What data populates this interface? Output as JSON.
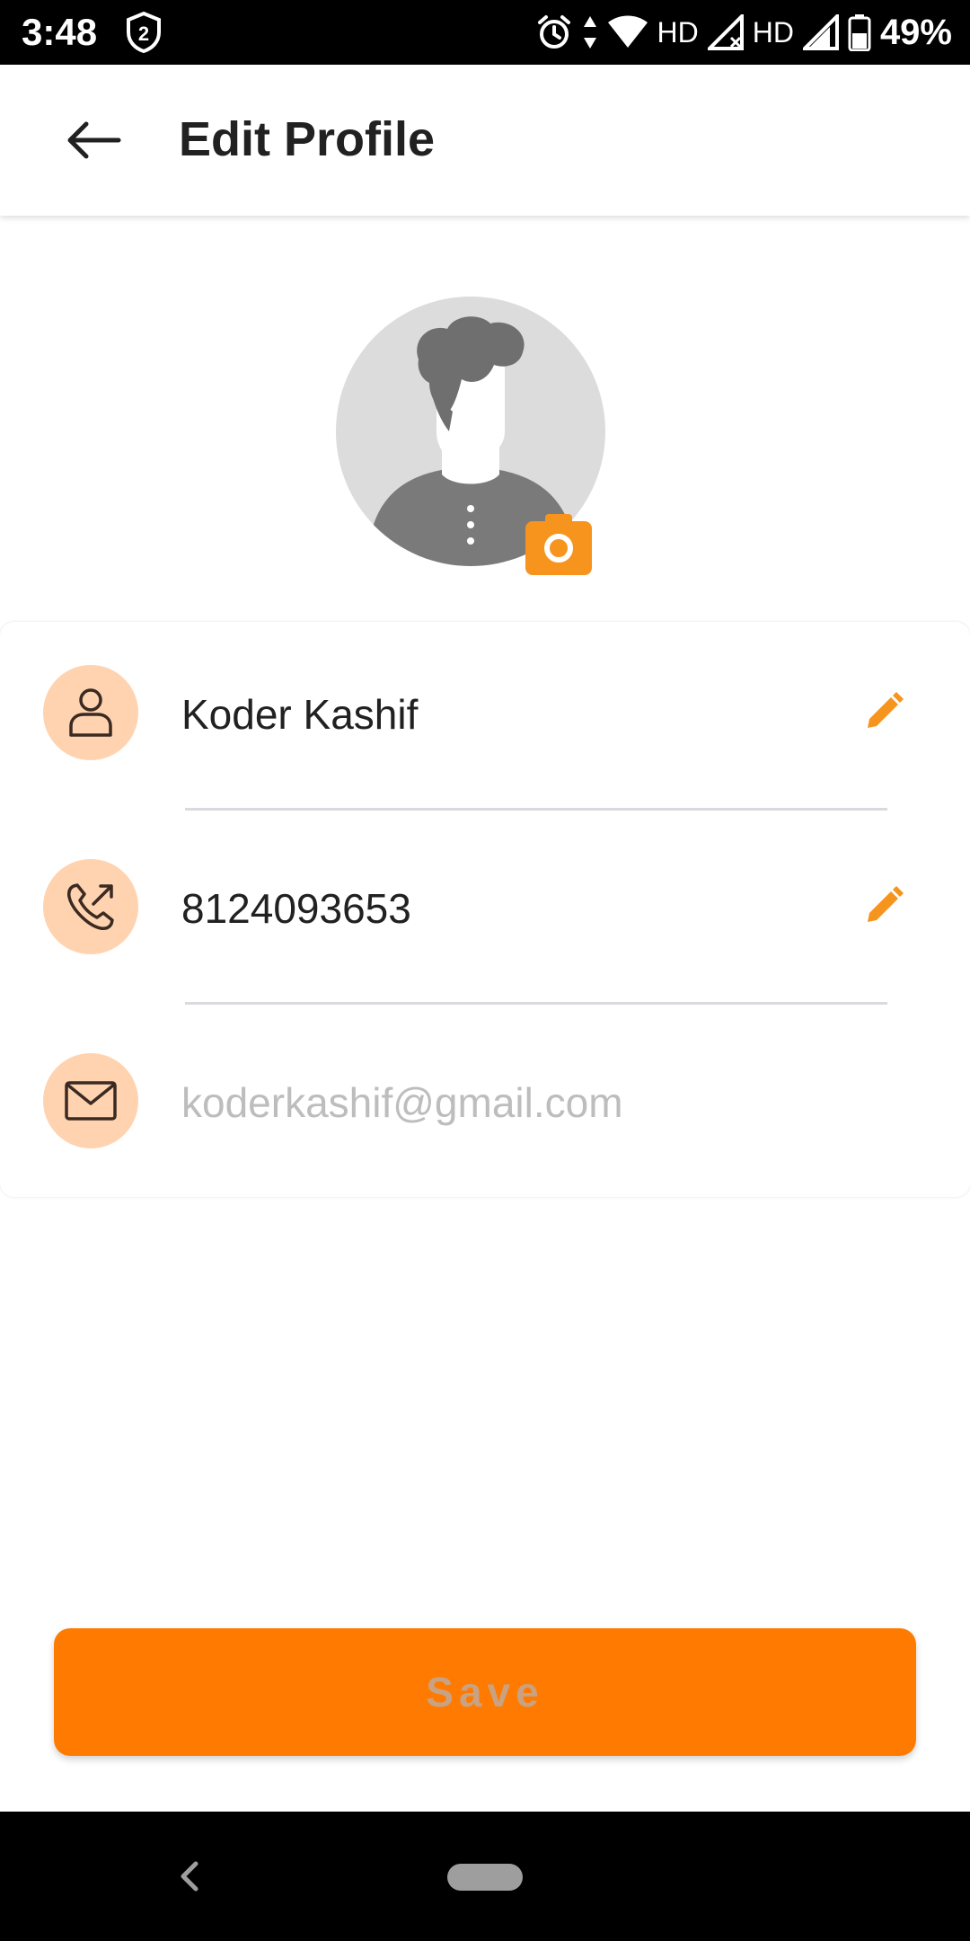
{
  "status_bar": {
    "time": "3:48",
    "notification_badge": "2",
    "network_1": "HD",
    "network_2": "HD",
    "battery_percent": "49%"
  },
  "header": {
    "title": "Edit Profile",
    "back_icon": "arrow-left-icon"
  },
  "profile": {
    "avatar_icon": "default-avatar",
    "camera_icon": "camera-icon"
  },
  "fields": [
    {
      "icon": "person-icon",
      "value": "Koder Kashif",
      "editable": true
    },
    {
      "icon": "phone-icon",
      "value": "8124093653",
      "editable": true
    },
    {
      "icon": "mail-icon",
      "value": "koderkashif@gmail.com",
      "editable": false
    }
  ],
  "actions": {
    "save_label": "Save"
  },
  "colors": {
    "accent": "#ff7a00",
    "icon_bg": "#ffd3b0",
    "edit_icon": "#f7941d"
  }
}
